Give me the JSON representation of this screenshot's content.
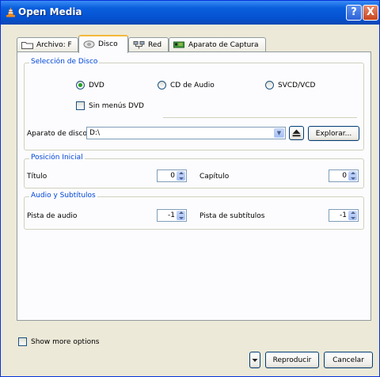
{
  "window": {
    "title": "Open Media",
    "help": "?",
    "close": "X"
  },
  "tabs": [
    {
      "label": "Archivo: F",
      "icon": "folder-icon"
    },
    {
      "label": "Disco",
      "icon": "disc-icon"
    },
    {
      "label": "Red",
      "icon": "network-icon"
    },
    {
      "label": "Aparato de Captura",
      "icon": "capture-card-icon"
    }
  ],
  "disc_selection": {
    "title": "Selección de Disco",
    "options": [
      "DVD",
      "CD de Audio",
      "SVCD/VCD"
    ],
    "selected": "DVD",
    "no_menus": "Sin menús DVD",
    "device_label": "Aparato de disco",
    "device_value": "D:\\",
    "browse": "Explorar..."
  },
  "start_position": {
    "title": "Posición Inicial",
    "title_label": "Título",
    "title_value": "0",
    "chapter_label": "Capítulo",
    "chapter_value": "0"
  },
  "audio_subs": {
    "title": "Audio y Subtítulos",
    "audio_label": "Pista de audio",
    "audio_value": "-1",
    "subs_label": "Pista de subtítulos",
    "subs_value": "-1"
  },
  "footer": {
    "more_options": "Show more options",
    "play": "Reproducir",
    "cancel": "Cancelar"
  },
  "colors": {
    "title_bar": "#0553d2",
    "group_title": "#0046d5",
    "tab_highlight": "#f5b839"
  }
}
